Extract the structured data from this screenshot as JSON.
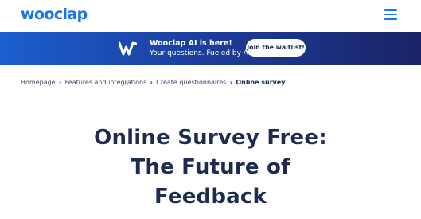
{
  "header": {
    "logo": "wooclap",
    "menu_icon": "hamburger-menu-icon"
  },
  "banner": {
    "badge_icon": "wooclap-w-logo-icon",
    "title": "Wooclap AI is here!",
    "subtitle": "Your questions. Fueled by AI.",
    "button_label": "Join the waitlist!"
  },
  "breadcrumb": {
    "items": [
      "Homepage",
      "Features and integrations",
      "Create questionnaires"
    ],
    "current": "Online survey",
    "separator_icon": "chevron-right-icon"
  },
  "hero": {
    "line1": "Online Survey Free:",
    "line2": "The Future of",
    "line3": "Feedback"
  },
  "colors": {
    "brand_blue": "#1b73e8",
    "navy_text": "#1d2b4f",
    "banner_gradient_start": "#1b5fcf",
    "banner_gradient_end": "#1a2466"
  }
}
